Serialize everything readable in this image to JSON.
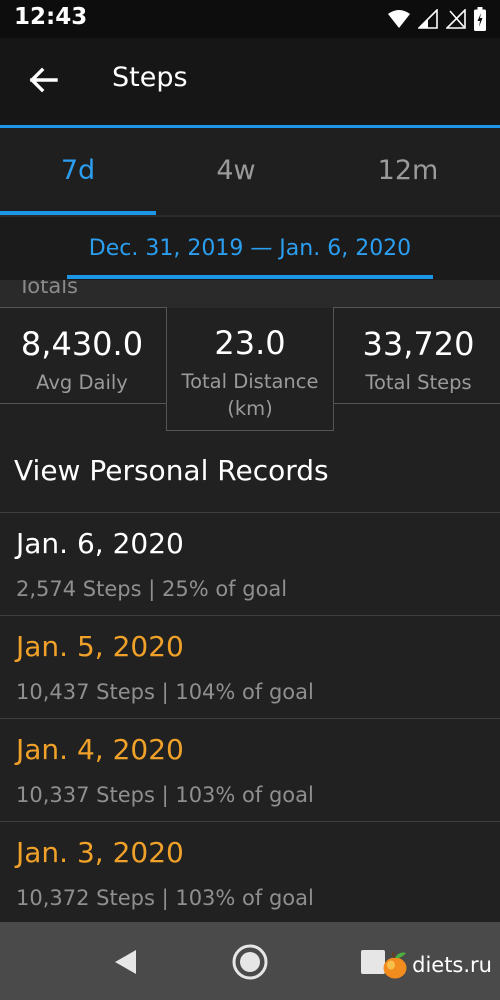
{
  "status_bar": {
    "time": "12:43"
  },
  "app_bar": {
    "title": "Steps"
  },
  "tabs": [
    {
      "label": "7d",
      "active": true
    },
    {
      "label": "4w",
      "active": false
    },
    {
      "label": "12m",
      "active": false
    }
  ],
  "date_range": "Dec. 31, 2019 — Jan. 6, 2020",
  "totals": {
    "header": "Totals",
    "avg_daily": {
      "value": "8,430.0",
      "label": "Avg Daily"
    },
    "total_distance": {
      "value": "23.0",
      "label_line1": "Total Distance",
      "label_line2": "(km)"
    },
    "total_steps": {
      "value": "33,720",
      "label": "Total Steps"
    }
  },
  "records_link": "View Personal Records",
  "days": [
    {
      "date": "Jan. 6, 2020",
      "detail": "2,574 Steps | 25% of goal",
      "goal_met": false
    },
    {
      "date": "Jan. 5, 2020",
      "detail": "10,437 Steps | 104% of goal",
      "goal_met": true
    },
    {
      "date": "Jan. 4, 2020",
      "detail": "10,337 Steps | 103% of goal",
      "goal_met": true
    },
    {
      "date": "Jan. 3, 2020",
      "detail": "10,372 Steps | 103% of goal",
      "goal_met": true
    }
  ],
  "watermark": "diets.ru",
  "colors": {
    "accent_blue": "#1e96e8",
    "goal_met_orange": "#f0a129"
  },
  "icons": [
    "wifi-icon",
    "signal-icon",
    "battery-icon",
    "back-arrow-icon",
    "nav-back-icon",
    "nav-home-icon",
    "nav-recents-icon"
  ]
}
